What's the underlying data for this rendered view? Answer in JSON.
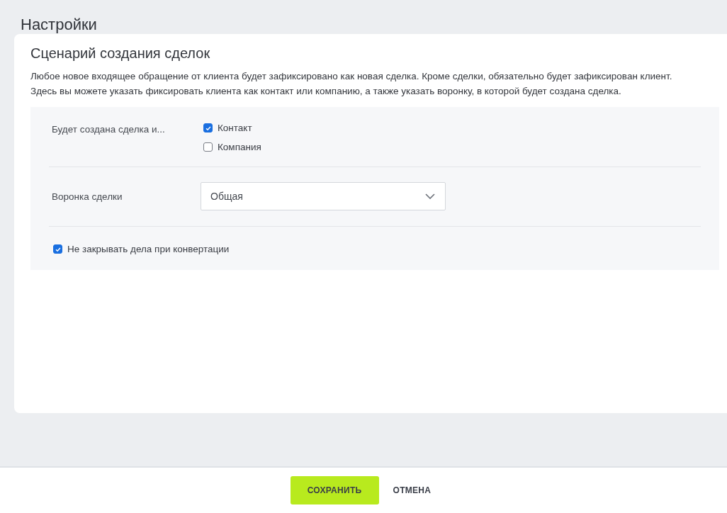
{
  "page_title": "Настройки",
  "card": {
    "title": "Сценарий создания сделок",
    "description": "Любое новое входящее обращение от клиента будет зафиксировано как новая сделка. Кроме сделки, обязательно будет зафиксирован клиент. Здесь вы можете указать фиксировать клиента как контакт или компанию, а также указать воронку, в которой будет создана сделка."
  },
  "entity_row": {
    "label": "Будет создана сделка и...",
    "options": [
      {
        "label": "Контакт",
        "checked": true
      },
      {
        "label": "Компания",
        "checked": false
      }
    ]
  },
  "pipeline_row": {
    "label": "Воронка сделки",
    "value": "Общая"
  },
  "keep_tasks": {
    "label": "Не закрывать дела при конвертации",
    "checked": true
  },
  "buttons": [
    {
      "label": "СОХРАНИТЬ",
      "kind": "primary"
    },
    {
      "label": "ОТМЕНА",
      "kind": "plain"
    }
  ]
}
